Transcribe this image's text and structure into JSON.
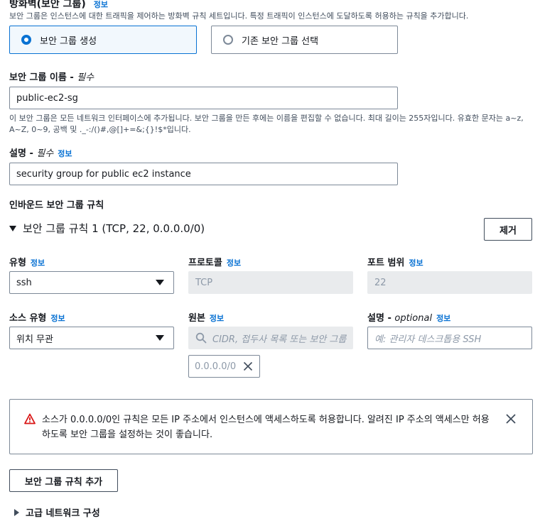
{
  "firewall": {
    "title": "방화벽(보안 그룹)",
    "info": "정보",
    "description": "보안 그룹은 인스턴스에 대한 트래픽을 제어하는 방화벽 규칙 세트입니다. 특정 트래픽이 인스턴스에 도달하도록 허용하는 규칙을 추가합니다.",
    "option_create": "보안 그룹 생성",
    "option_existing": "기존 보안 그룹 선택"
  },
  "sg_name": {
    "label": "보안 그룹 이름 - ",
    "required": "필수",
    "value": "public-ec2-sg",
    "help_line1": "이 보안 그룹은 모든 네트워크 인터페이스에 추가됩니다. 보안 그룹을 만든 후에는 이름을 편집할 수 없습니다. 최대 길이는 255자입니다. 유효한 문자는 a~z,",
    "help_line2": "A~Z, 0~9, 공백 및 ._-:/()#,@[]+=&;{}!$*입니다."
  },
  "sg_desc": {
    "label": "설명 - ",
    "required": "필수",
    "info": "정보",
    "value": "security group for public ec2 instance"
  },
  "inbound": {
    "title": "인바운드 보안 그룹 규칙",
    "rule_title": "보안 그룹 규칙 1 (TCP, 22, 0.0.0.0/0)",
    "remove_button": "제거",
    "type_label": "유형",
    "protocol_label": "프로토콜",
    "port_label": "포트 범위",
    "info": "정보",
    "type_value": "ssh",
    "protocol_value": "TCP",
    "port_value": "22",
    "source_type_label": "소스 유형",
    "source_label": "원본",
    "desc_label": "설명 - ",
    "desc_optional": "optional",
    "source_type_value": "위치 무관",
    "source_placeholder": "CIDR, 접두사 목록 또는 보안 그룹",
    "desc_placeholder": "예: 관리자 데스크톱용 SSH",
    "token_value": "0.0.0.0/0"
  },
  "warning": {
    "line1": "소스가 0.0.0.0/0인 규칙은 모든 IP 주소에서 인스턴스에 액세스하도록 허용합니다. 알려진 IP 주소의 액세스만 허용",
    "line2": "하도록 보안 그룹을 설정하는 것이 좋습니다."
  },
  "add_rule_button": "보안 그룹 규칙 추가",
  "advanced": "고급 네트워크 구성"
}
